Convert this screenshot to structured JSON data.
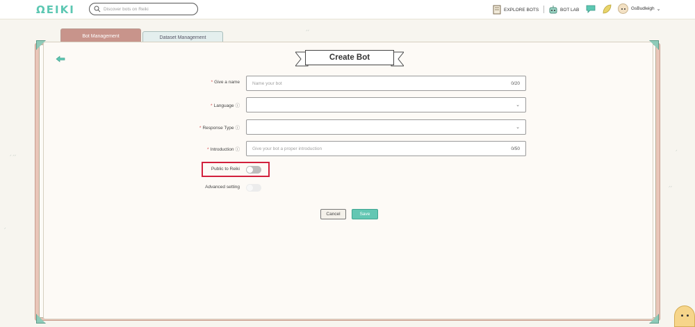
{
  "header": {
    "logo": "ΩEIKI",
    "search_placeholder": "Discover bots on Reiki",
    "explore_label": "EXPLORE BOTS",
    "botlab_label": "BOT LAB",
    "username": "GsBudleigh"
  },
  "tabs": [
    {
      "label": "Bot Management",
      "active": true
    },
    {
      "label": "Dataset Management",
      "active": false
    }
  ],
  "page_title": "Create Bot",
  "form": {
    "name": {
      "label": "Give a name",
      "placeholder": "Name your bot",
      "counter": "0/20"
    },
    "language": {
      "label": "Language",
      "value": ""
    },
    "response_type": {
      "label": "Response Type",
      "value": ""
    },
    "introduction": {
      "label": "Introduction",
      "placeholder": "Give your bot a proper introduction",
      "counter": "0/50"
    },
    "public": {
      "label": "Public to Reiki",
      "enabled": false
    },
    "advanced": {
      "label": "Advanced setting",
      "enabled": false
    }
  },
  "buttons": {
    "cancel": "Cancel",
    "save": "Save"
  },
  "colors": {
    "accent": "#63c7b3",
    "tab_active": "#c8948b",
    "highlight": "#d21f3c"
  }
}
